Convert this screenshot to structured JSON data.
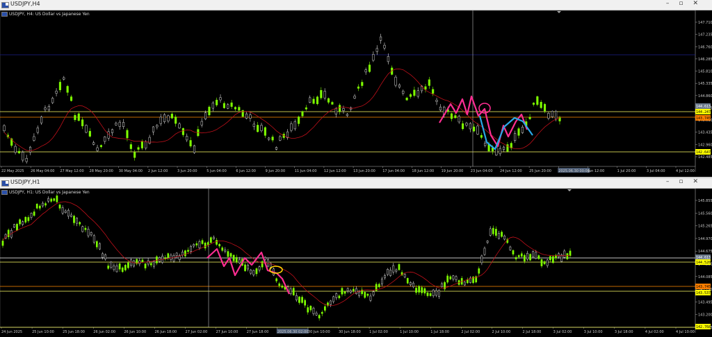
{
  "top": {
    "window_title": "USDJPY,H4",
    "info": "USDJPY, H4:  US Dollar vs Japanese Yen",
    "price_levels": [
      "147.710",
      "147.235",
      "146.760",
      "146.285",
      "145.810",
      "145.335",
      "144.860",
      "144.385",
      "143.910",
      "143.435",
      "142.960",
      "142.485"
    ],
    "time_labels": [
      "22 May 2025",
      "26 May 04:00",
      "27 May 12:00",
      "28 May 20:00",
      "30 May 04:00",
      "2 Jun 12:00",
      "3 Jun 20:00",
      "5 Jun 04:00",
      "6 Jun 12:00",
      "9 Jun 20:00",
      "11 Jun 04:00",
      "12 Jun 12:00",
      "13 Jun 20:00",
      "17 Jun 04:00",
      "18 Jun 12:00",
      "19 Jun 20:00",
      "23 Jun 04:00",
      "24 Jun 12:00",
      "25 Jun 20:00",
      "2025.06.30 00:00",
      "Jun 12:00",
      "1 Jul 20:00",
      "3 Jul 04:00",
      "4 Jul 12:00"
    ],
    "tags": [
      {
        "text": "144.613",
        "bg": "#6c7a8c",
        "fg": "#ffffff"
      },
      {
        "text": "144.247",
        "bg": "#ffff00",
        "fg": "#000000"
      },
      {
        "text": "143.745",
        "bg": "#ff7f00",
        "fg": "#000000"
      },
      {
        "text": "142.647",
        "bg": "#ffff00",
        "fg": "#000000"
      }
    ]
  },
  "bottom": {
    "window_title": "USDJPY,H1",
    "info": "USDJPY, H1:  US Dollar vs Japanese Yen",
    "price_levels": [
      "145.855",
      "145.560",
      "145.265",
      "144.970",
      "144.675",
      "144.380",
      "144.085",
      "143.790",
      "143.495",
      "143.200",
      "142.905"
    ],
    "time_labels": [
      "24 Jun 2025",
      "25 Jun 10:00",
      "25 Jun 18:00",
      "26 Jun 02:00",
      "26 Jun 10:00",
      "26 Jun 18:00",
      "27 Jun 02:00",
      "27 Jun 10:00",
      "27 Jun 18:00",
      "2025.06.30 02:00",
      "30 Jun 10:00",
      "30 Jun 18:00",
      "1 Jul 02:00",
      "1 Jul 10:00",
      "1 Jul 18:00",
      "2 Jul 02:00",
      "2 Jul 10:00",
      "2 Jul 18:00",
      "3 Jul 02:00",
      "3 Jul 10:00",
      "3 Jul 18:00",
      "4 Jul 02:00",
      "4 Jul 10:00"
    ],
    "tags": [
      {
        "text": "144.613",
        "bg": "#6c7a8c",
        "fg": "#ffffff"
      },
      {
        "text": "144.520",
        "bg": "#ffff00",
        "fg": "#000000"
      },
      {
        "text": "143.745",
        "bg": "#ff7f00",
        "fg": "#000000"
      },
      {
        "text": "143.537",
        "bg": "#ffff00",
        "fg": "#000000"
      },
      {
        "text": "142.768",
        "bg": "#ffff00",
        "fg": "#000000"
      }
    ]
  },
  "colors": {
    "bull": "#7fff00",
    "bear": "#dddddd",
    "ma": "#c0101a",
    "level_yellow": "#ffff66",
    "level_orange": "#ff8c00",
    "level_blue": "#1e2a9a",
    "pink": "#ff2d92",
    "cyan": "#2aa8e8"
  }
}
